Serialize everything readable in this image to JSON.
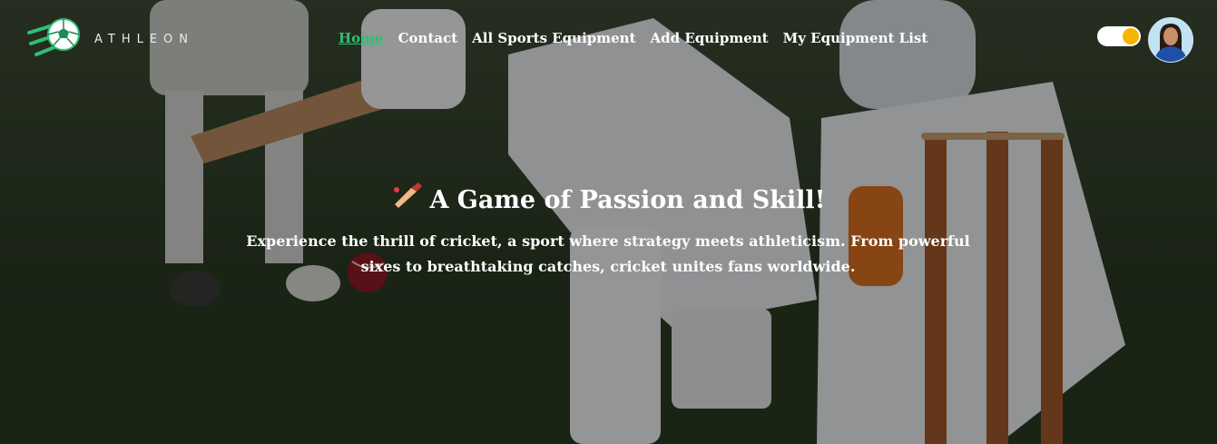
{
  "brand": {
    "name": "ATHLEON"
  },
  "nav": {
    "links": [
      "Home",
      "Contact",
      "All Sports Equipment",
      "Add Equipment",
      "My Equipment List"
    ],
    "active": "Home",
    "active_color": "#2fbf71"
  },
  "theme_toggle": {
    "state": "on",
    "knob_color": "#f5b400"
  },
  "hero": {
    "title": "A Game of Passion and Skill!",
    "title_icon": "cricket-bat-icon",
    "subtitle": "Experience the thrill of cricket, a sport where strategy meets athleticism. From powerful sixes to breathtaking catches, cricket unites fans worldwide."
  }
}
